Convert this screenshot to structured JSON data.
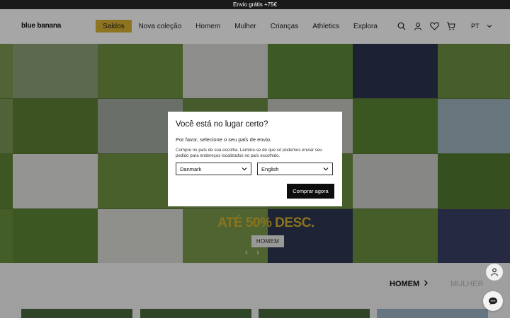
{
  "topbar": {
    "text": "Envio grátis +75€"
  },
  "header": {
    "logo": "blue banana",
    "nav": [
      {
        "label": "Saldos"
      },
      {
        "label": "Nova coleção"
      },
      {
        "label": "Homem"
      },
      {
        "label": "Mulher"
      },
      {
        "label": "Crianças"
      },
      {
        "label": "Athletics"
      },
      {
        "label": "Explora"
      }
    ],
    "icons": [
      "search-icon",
      "user-icon",
      "heart-icon",
      "cart-icon"
    ],
    "lang": "PT"
  },
  "hero": {
    "promo_text": "ATÉ 50% DESC.",
    "tag": "HOMEM",
    "prev": "‹",
    "next": "›"
  },
  "modal": {
    "title": "Você está no lugar certo?",
    "subtitle": "Por favor, selecione o seu país de envio.",
    "note": "Compre no país de sua escolha. Lembre-se de que só podemos enviar seu pedido para endereços localizados no país escolhido.",
    "country_value": "Danmark",
    "language_value": "English",
    "button": "Comprar agora"
  },
  "categories": {
    "homem": "HOMEM",
    "mulher": "MULHER"
  },
  "colors": {
    "accent": "#d9b234",
    "topbar": "#1a1a1a",
    "button": "#0d0d0d"
  }
}
